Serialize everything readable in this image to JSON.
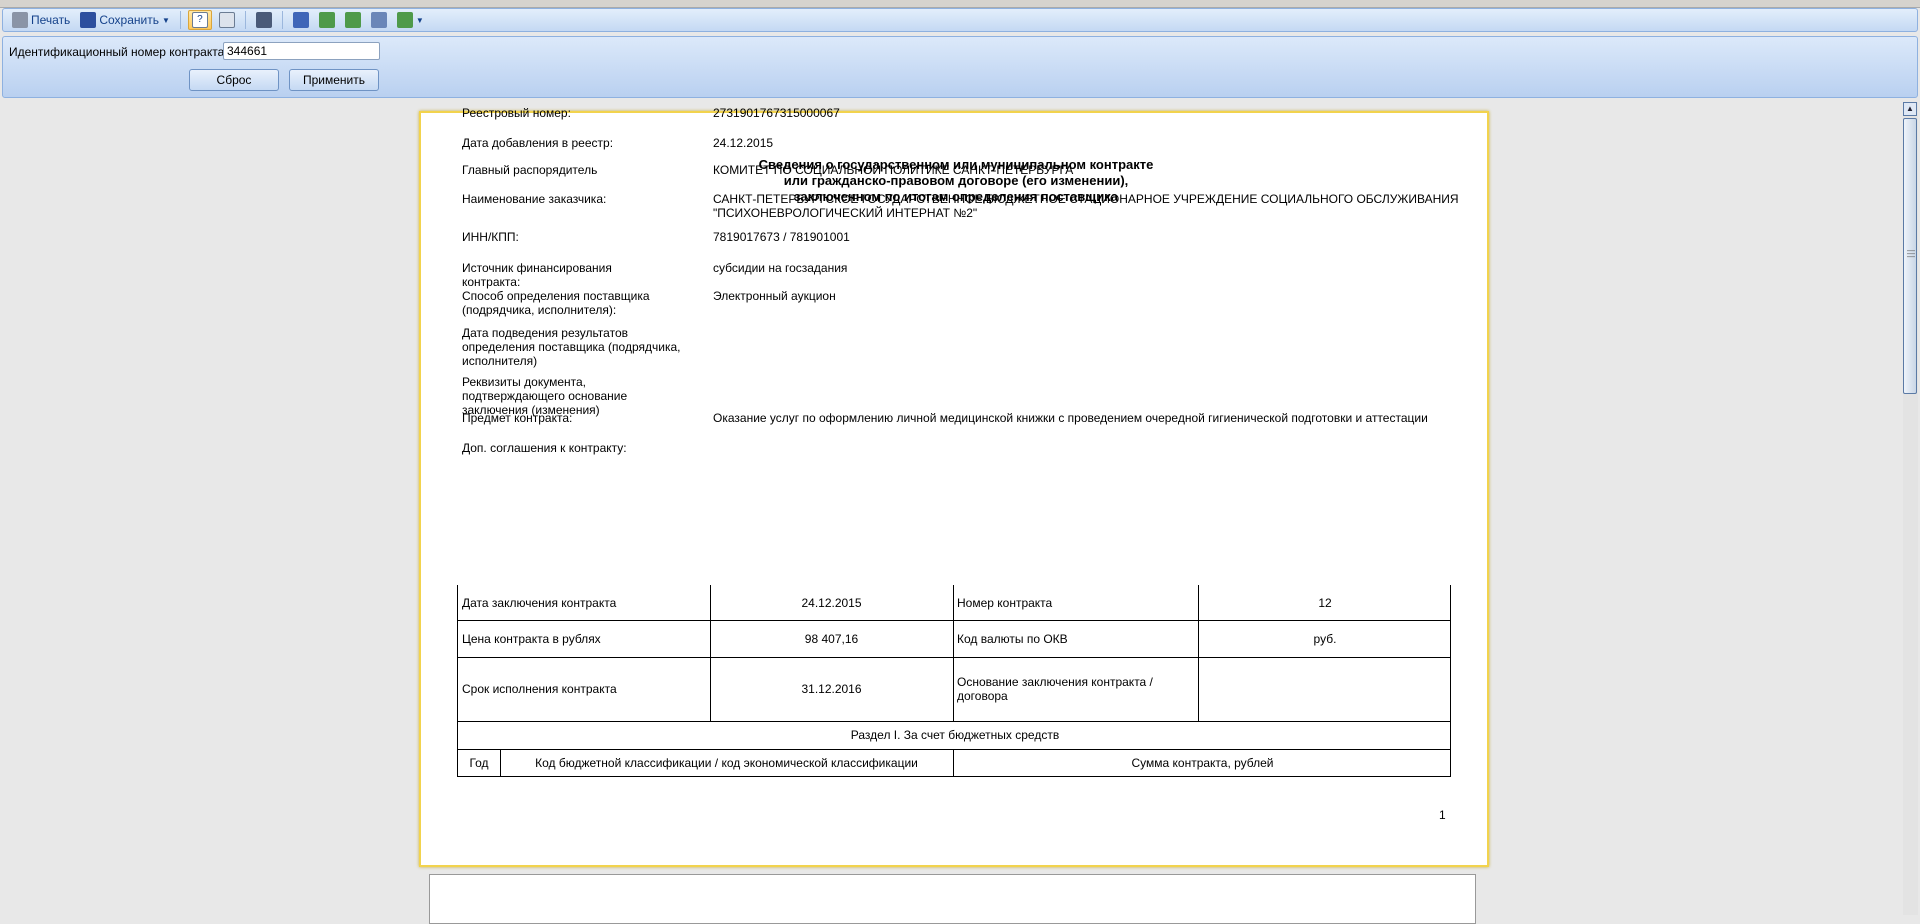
{
  "toolbar": {
    "print_label": "Печать",
    "save_label": "Сохранить"
  },
  "filter": {
    "contract_id_label": "Идентификационный номер контракта",
    "contract_id_value": "344661",
    "reset_label": "Сброс",
    "apply_label": "Применить"
  },
  "report": {
    "title_lines": [
      "Сведения о государственном или муниципальном контракте",
      "или гражданско-правовом договоре (его изменении),",
      "заключенном по итогам определения поставщика"
    ],
    "fields": [
      {
        "label": "Реестровый номер:",
        "value": "2731901767315000067"
      },
      {
        "label": "Дата добавления в реестр:",
        "value": "24.12.2015"
      },
      {
        "label": "Главный распорядитель",
        "value": "КОМИТЕТ ПО СОЦИАЛЬНОЙ ПОЛИТИКЕ САНКТ-ПЕТЕРБУРГА"
      },
      {
        "label": "Наименование заказчика:",
        "value": "САНКТ-ПЕТЕРБУРГСКОЕ ГОСУДАРСТВЕННОЕ БЮДЖЕТНОЕ СТАЦИОНАРНОЕ УЧРЕЖДЕНИЕ СОЦИАЛЬНОГО ОБСЛУЖИВАНИЯ \"ПСИХОНЕВРОЛОГИЧЕСКИЙ ИНТЕРНАТ №2\""
      },
      {
        "label": "ИНН/КПП:",
        "value": "7819017673 / 781901001"
      },
      {
        "label": "Источник финансирования контракта:",
        "value": "субсидии на госзадания"
      },
      {
        "label": "Способ определения поставщика (подрядчика, исполнителя):",
        "value": "Электронный аукцион"
      },
      {
        "label": "Дата подведения результатов определения поставщика (подрядчика, исполнителя)",
        "value": ""
      },
      {
        "label": "Реквизиты документа, подтверждающего основание заключения (изменения)",
        "value": ""
      },
      {
        "label": "Предмет контракта:",
        "value": "Оказание услуг по оформлению личной медицинской книжки с проведением очередной гигиенической подготовки и аттестации"
      },
      {
        "label": "Доп. соглашения к контракту:",
        "value": ""
      }
    ],
    "table": {
      "rows": [
        [
          "Дата заключения контракта",
          "24.12.2015",
          "Номер контракта",
          "12"
        ],
        [
          "Цена контракта в рублях",
          "98 407,16",
          "Код валюты по ОКВ",
          "руб."
        ],
        [
          "Срок исполнения контракта",
          "31.12.2016",
          "Основание заключения контракта / договора",
          ""
        ]
      ],
      "section_title": "Раздел I. За счет бюджетных средств",
      "headers": [
        "Год",
        "Код бюджетной классификации / код экономической классификации",
        "Сумма контракта, рублей"
      ]
    },
    "page_number": "1"
  }
}
